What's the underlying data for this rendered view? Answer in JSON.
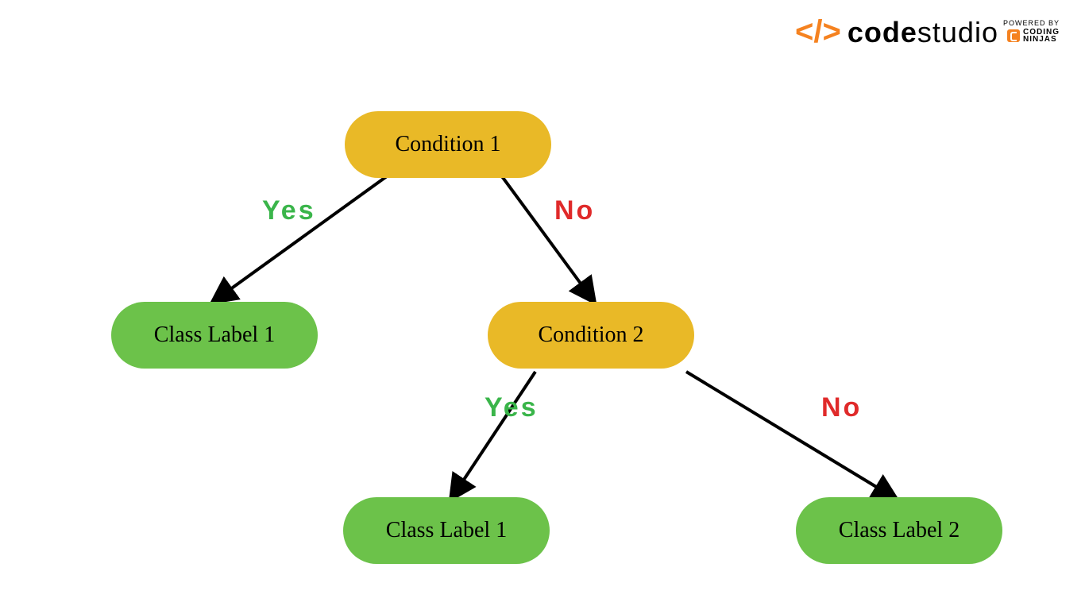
{
  "logo": {
    "brand_bold": "code",
    "brand_light": "studio",
    "powered": "POWERED BY",
    "ninjas_l1": "CODING",
    "ninjas_l2": "NINJAS"
  },
  "nodes": {
    "cond1": "Condition 1",
    "cond2": "Condition 2",
    "leaf1": "Class Label 1",
    "leaf2": "Class Label 1",
    "leaf3": "Class Label 2"
  },
  "edges": {
    "yes": "Yes",
    "no": "No"
  },
  "colors": {
    "condition": "#e9b927",
    "leaf": "#6cc24a",
    "yes": "#3ab54a",
    "no": "#e02a2a",
    "accent": "#f58220"
  }
}
